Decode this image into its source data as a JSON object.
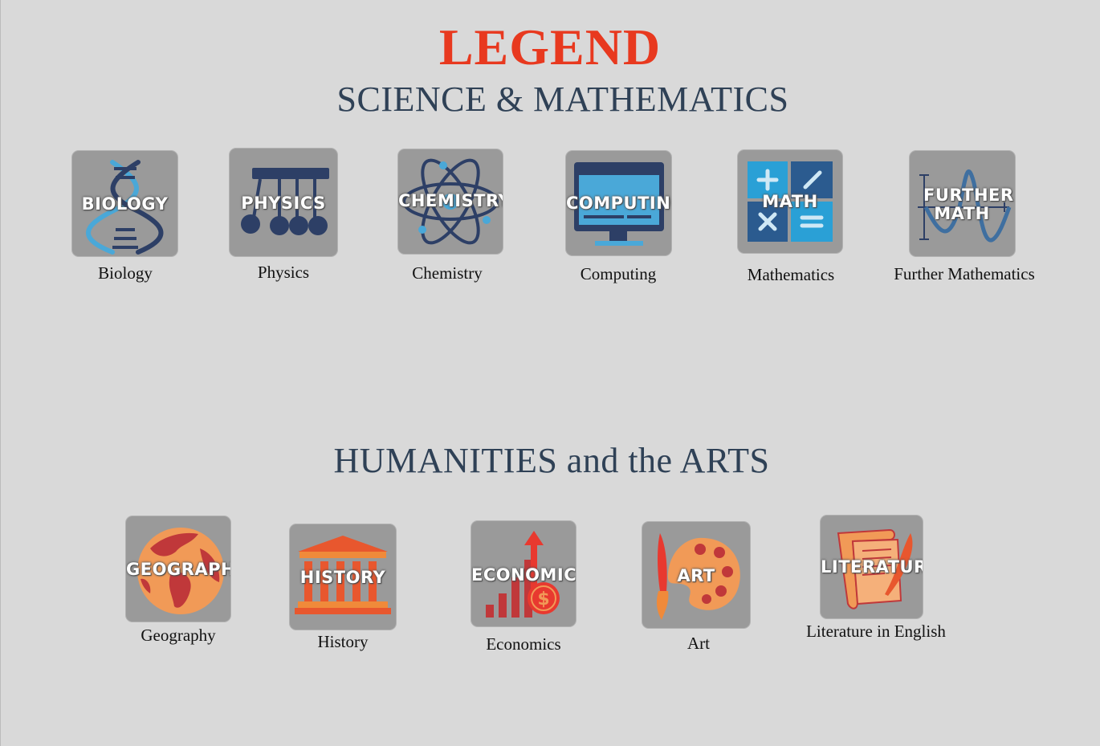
{
  "title": "LEGEND",
  "sections": [
    {
      "heading": "SCIENCE & MATHEMATICS",
      "subjects": [
        {
          "tile_label": "BIOLOGY",
          "caption": "Biology",
          "icon": "dna-icon"
        },
        {
          "tile_label": "PHYSICS",
          "caption": "Physics",
          "icon": "newtons-cradle-icon"
        },
        {
          "tile_label": "CHEMISTRY",
          "caption": "Chemistry",
          "icon": "atom-icon"
        },
        {
          "tile_label": "COMPUTING",
          "caption": "Computing",
          "icon": "monitor-code-icon"
        },
        {
          "tile_label": "MATH",
          "caption": "Mathematics",
          "icon": "calculator-icon"
        },
        {
          "tile_label": "FURTHER MATH",
          "caption": "Further Mathematics",
          "icon": "sine-wave-icon"
        }
      ]
    },
    {
      "heading": "HUMANITIES and the ARTS",
      "subjects": [
        {
          "tile_label": "GEOGRAPHY",
          "caption": "Geography",
          "icon": "globe-icon"
        },
        {
          "tile_label": "HISTORY",
          "caption": "History",
          "icon": "pillared-building-icon"
        },
        {
          "tile_label": "ECONOMICS",
          "caption": "Economics",
          "icon": "rising-bar-chart-icon"
        },
        {
          "tile_label": "ART",
          "caption": "Art",
          "icon": "palette-brush-icon"
        },
        {
          "tile_label": "LITERATURE",
          "caption": "Literature in English",
          "icon": "scroll-quill-icon"
        }
      ]
    }
  ],
  "colors": {
    "title": "#e8391f",
    "heading": "#2f4156",
    "background": "#d9d9d9",
    "tile": "#9a9a9a"
  }
}
